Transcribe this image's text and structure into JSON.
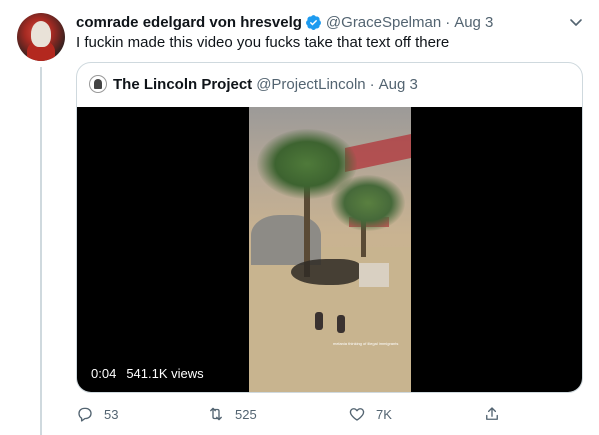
{
  "tweet": {
    "display_name": "comrade edelgard von hresvelg",
    "handle": "@GraceSpelman",
    "separator": "·",
    "date": "Aug 3",
    "text": "I fuckin made this video you fucks take that text off there"
  },
  "quote": {
    "display_name": "The Lincoln Project",
    "handle": "@ProjectLincoln",
    "separator": "·",
    "date": "Aug 3",
    "video": {
      "elapsed": "0:04",
      "views": "541.1K views",
      "caption": "melania thinking of illegal immigrants"
    }
  },
  "actions": {
    "reply_count": "53",
    "retweet_count": "525",
    "like_count": "7K"
  },
  "colors": {
    "verified": "#1d9bf0",
    "secondary_text": "#536471",
    "border": "#cfd9de"
  },
  "icons": [
    "verified-badge-icon",
    "chevron-down-icon",
    "reply-icon",
    "retweet-icon",
    "like-icon",
    "share-icon"
  ]
}
